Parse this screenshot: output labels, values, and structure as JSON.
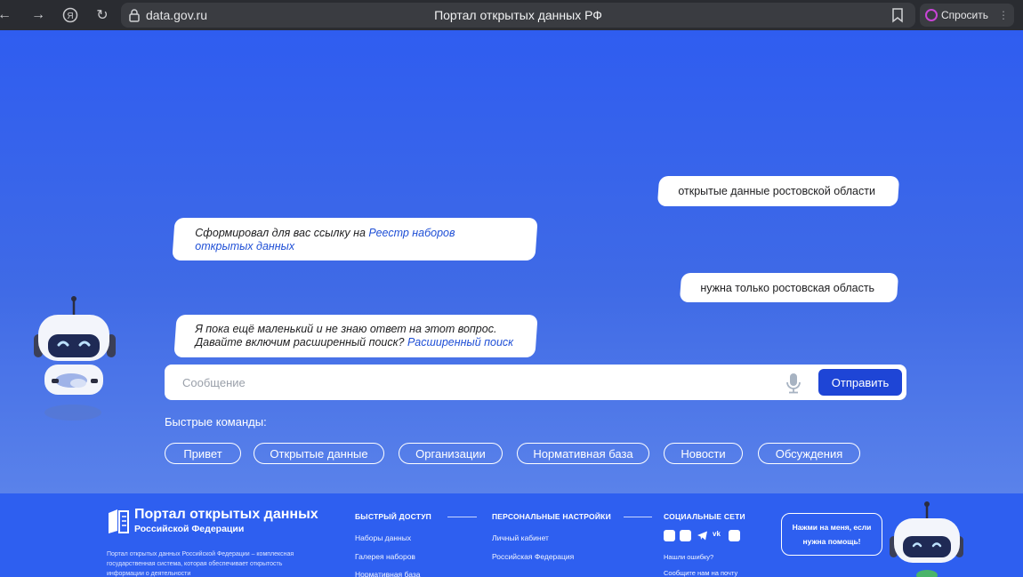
{
  "browser": {
    "url": "data.gov.ru",
    "tab_title": "Портал открытых данных РФ",
    "ask_label": "Спросить"
  },
  "chat": {
    "messages": [
      {
        "from": "user",
        "text": "открытые данные ростовской области"
      },
      {
        "from": "bot",
        "text": "Сформировал для вас ссылку на ",
        "link": "Реестр наборов открытых данных"
      },
      {
        "from": "user",
        "text": "нужна только ростовская область"
      },
      {
        "from": "bot",
        "line1": "Я пока ещё маленький и не знаю ответ на этот вопрос.",
        "line2": "Давайте включим расширенный поиск? ",
        "link": "Расширенный поиск"
      }
    ],
    "input_placeholder": "Сообщение",
    "send_label": "Отправить",
    "quick_label": "Быстрые команды:",
    "quick_commands": [
      "Привет",
      "Открытые данные",
      "Организации",
      "Нормативная база",
      "Новости",
      "Обсуждения"
    ]
  },
  "footer": {
    "logo_title": "Портал открытых данных",
    "logo_subtitle": "Российской Федерации",
    "description": "Портал открытых данных Российской Федерации – комплексная государственная система, которая обеспечивает открытость информации о деятельности",
    "quick_access": {
      "heading": "БЫСТРЫЙ ДОСТУП",
      "links": [
        "Наборы данных",
        "Галерея наборов",
        "Нормативная база"
      ]
    },
    "personal": {
      "heading": "ПЕРСОНАЛЬНЫЕ НАСТРОЙКИ",
      "links": [
        "Личный кабинет",
        "Российская Федерация"
      ]
    },
    "social": {
      "heading": "СОЦИАЛЬНЫЕ СЕТИ",
      "links": [
        "Нашли ошибку?",
        "Сообщите нам на почту"
      ]
    },
    "help_text_1": "Нажми на меня, если",
    "help_text_2": "нужна помощь!"
  },
  "colors": {
    "accent": "#1e45d6",
    "background": "#3a63e6",
    "footer": "#2e5ff0"
  }
}
